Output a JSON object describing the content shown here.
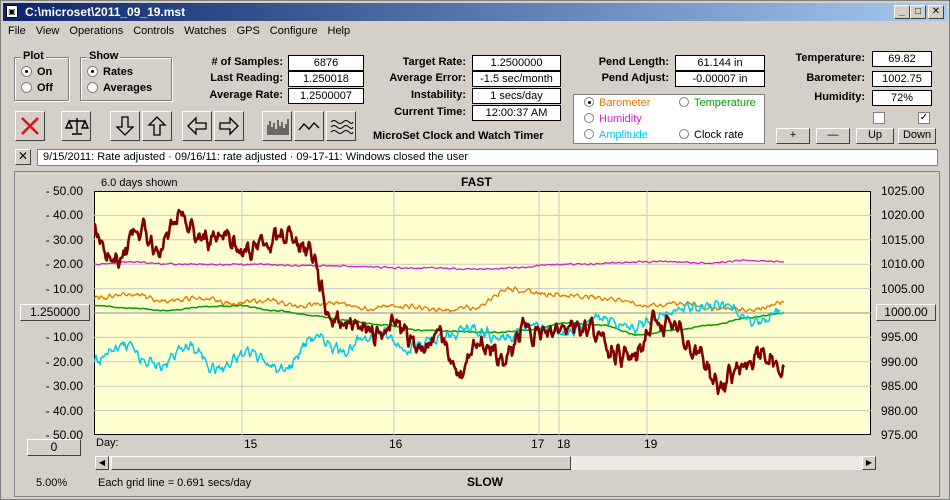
{
  "window": {
    "title": "C:\\microset\\2011_09_19.mst",
    "app_icon": "app-icon"
  },
  "menu": [
    "File",
    "View",
    "Operations",
    "Controls",
    "Watches",
    "GPS",
    "Configure",
    "Help"
  ],
  "plot_group": {
    "title": "Plot",
    "on": "On",
    "off": "Off",
    "selected": "On"
  },
  "show_group": {
    "title": "Show",
    "rates": "Rates",
    "averages": "Averages",
    "selected": "Rates"
  },
  "stats": {
    "samples_label": "# of Samples:",
    "samples": "6876",
    "last_reading_label": "Last Reading:",
    "last_reading": "1.250018",
    "average_rate_label": "Average Rate:",
    "average_rate": "1.2500007",
    "target_rate_label": "Target Rate:",
    "target_rate": "1.2500000",
    "average_error_label": "Average Error:",
    "average_error": "-1.5 sec/month",
    "instability_label": "Instability:",
    "instability": "1 secs/day",
    "current_time_label": "Current Time:",
    "current_time": "12:00:37 AM",
    "pend_length_label": "Pend Length:",
    "pend_length": "61.144 in",
    "pend_adjust_label": "Pend Adjust:",
    "pend_adjust": "-0.00007 in",
    "temperature_label": "Temperature:",
    "temperature": "69.82",
    "barometer_label": "Barometer:",
    "barometer": "1002.75",
    "humidity_label": "Humidity:",
    "humidity": "72%"
  },
  "app_caption": "MicroSet Clock and Watch Timer",
  "legend": {
    "barometer": "Barometer",
    "temperature": "Temperature",
    "humidity": "Humidity",
    "amplitude": "Amplitude",
    "clock_rate": "Clock rate",
    "selected": "Barometer",
    "colors": {
      "barometer": "#e07800",
      "temperature": "#00a000",
      "humidity": "#d020d0",
      "amplitude": "#00c8e8",
      "clock_rate": "#000000"
    }
  },
  "adjust_buttons": {
    "plus": "+",
    "minus": "—",
    "up": "Up",
    "down": "Down"
  },
  "checkboxes": {
    "left_checked": false,
    "right_checked": true
  },
  "status_message": "9/15/2011: Rate adjusted  · 09/16/11: rate adjusted  · 09-17-11: Windows closed the user",
  "chart": {
    "days_shown": "6.0 days shown",
    "top_label": "FAST",
    "bottom_label": "SLOW",
    "grid_note": "Each grid line = 0.691 secs/day",
    "zoom": "5.00%",
    "center_left_button": "1.250000",
    "center_right_button": "1000.00",
    "zero_button": "0",
    "day_label": "Day:",
    "day_ticks": [
      "15",
      "17",
      "18",
      "19"
    ]
  },
  "chart_data": {
    "type": "line",
    "title": "",
    "x_label": "Day:",
    "left_axis_ticks": [
      "50.00",
      "40.00",
      "30.00",
      "20.00",
      "10.00",
      "1.250000",
      "10.00",
      "20.00",
      "30.00",
      "40.00",
      "50.00"
    ],
    "right_axis_ticks": [
      "1025.00",
      "1020.00",
      "1015.00",
      "1010.00",
      "1005.00",
      "1000.00",
      "995.00",
      "990.00",
      "985.00",
      "980.00",
      "975.00"
    ],
    "series": [
      {
        "name": "Clock rate",
        "color": "#800000",
        "anchors": [
          34,
          20,
          35,
          27,
          38,
          30,
          33,
          25,
          28,
          32,
          26,
          -2,
          -4,
          -8,
          -5,
          -14,
          -10,
          -25,
          -12,
          -20,
          -6,
          -9,
          -4,
          -6,
          -15,
          -19,
          -4,
          -7,
          -16,
          -30,
          -22,
          -17,
          -24
        ]
      },
      {
        "name": "Humidity",
        "color": "#d020d0",
        "anchors": [
          20,
          21,
          20,
          20,
          20,
          19.5,
          19.5,
          19,
          18.5,
          18.5,
          18,
          18.5,
          20,
          20,
          21,
          21,
          20.5,
          21.5,
          21
        ]
      },
      {
        "name": "Barometer",
        "color": "#e07800",
        "anchors": [
          6,
          8,
          5,
          6,
          4,
          5,
          3,
          4,
          2,
          3,
          1,
          2,
          10,
          8,
          7,
          6,
          3,
          4,
          2,
          1.5,
          4
        ]
      },
      {
        "name": "Temperature",
        "color": "#00a000",
        "anchors": [
          3,
          2,
          1,
          2.5,
          3,
          1,
          -1,
          -3,
          -5,
          -7,
          -7.5,
          -8,
          -7,
          -4,
          -5,
          -9,
          -7,
          -5,
          -2,
          0
        ]
      },
      {
        "name": "Amplitude",
        "color": "#00c8e8",
        "anchors": [
          -20,
          -13,
          -22,
          -14,
          -23,
          -16,
          -24,
          -10,
          -15,
          -8,
          -14,
          -11,
          -6,
          -10,
          -5,
          -9,
          -2,
          -7,
          -1,
          2,
          4,
          -3,
          0
        ]
      }
    ],
    "y_range": [
      -50,
      50
    ],
    "x_days": [
      "15",
      "17",
      "18",
      "19"
    ]
  }
}
